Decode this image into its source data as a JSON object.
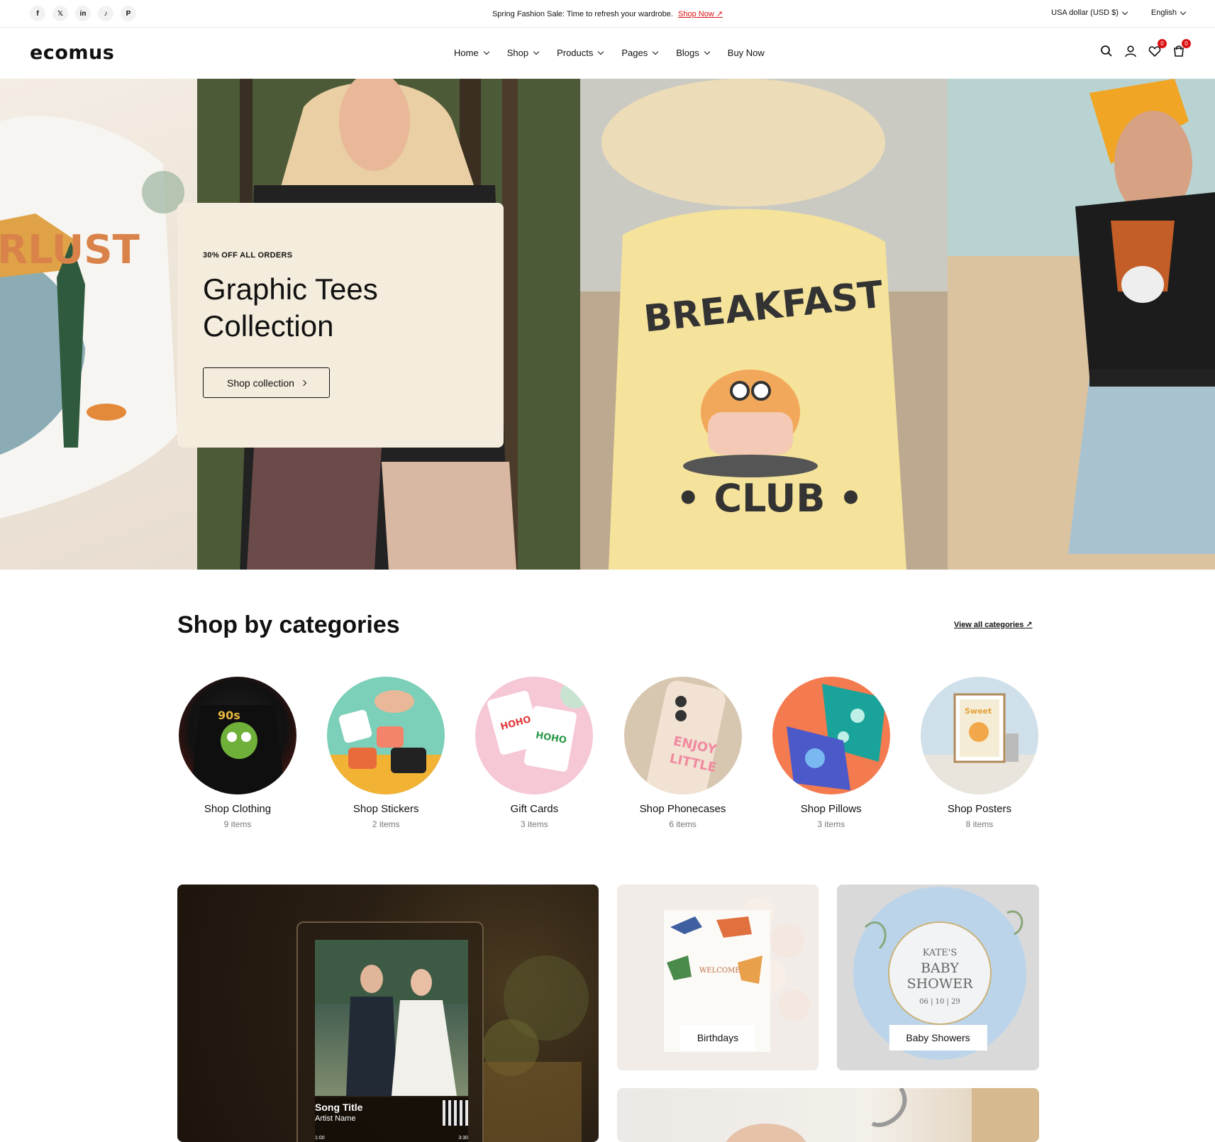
{
  "topbar": {
    "socials": [
      {
        "icon": "facebook-icon",
        "glyph": "f"
      },
      {
        "icon": "x-icon",
        "glyph": "𝕏"
      },
      {
        "icon": "linkedin-icon",
        "glyph": "in"
      },
      {
        "icon": "tiktok-icon",
        "glyph": "♪"
      },
      {
        "icon": "pinterest-icon",
        "glyph": "P"
      }
    ],
    "announcement": "Spring Fashion Sale: Time to refresh your wardrobe.",
    "announcement_link": "Shop Now ↗",
    "currency": "USA dollar (USD $)",
    "language": "English"
  },
  "header": {
    "logo": "ecomus",
    "nav": [
      "Home",
      "Shop",
      "Products",
      "Pages",
      "Blogs",
      "Buy Now"
    ],
    "wishlist_count": "0",
    "cart_count": "0"
  },
  "hero": {
    "tag": "30% OFF ALL ORDERS",
    "title_line1": "Graphic Tees",
    "title_line2": "Collection",
    "button": "Shop collection"
  },
  "categories": {
    "title": "Shop by categories",
    "view_all": "View all categories ↗",
    "items": [
      {
        "name": "Shop Clothing",
        "count": "9 items",
        "colors": [
          "#7a1a12",
          "#111111"
        ]
      },
      {
        "name": "Shop Stickers",
        "count": "2 items",
        "colors": [
          "#7ccfb8",
          "#f2b233"
        ]
      },
      {
        "name": "Gift Cards",
        "count": "3 items",
        "colors": [
          "#f6c7d4",
          "#ffffff"
        ]
      },
      {
        "name": "Shop Phonecases",
        "count": "6 items",
        "colors": [
          "#d8c7b0",
          "#f1e2d3"
        ]
      },
      {
        "name": "Shop Pillows",
        "count": "3 items",
        "colors": [
          "#f47a4f",
          "#1aa39a"
        ]
      },
      {
        "name": "Shop Posters",
        "count": "8 items",
        "colors": [
          "#cfe0ea",
          "#e9e5dc"
        ]
      }
    ]
  },
  "collections": {
    "song_title": "Song Title",
    "artist_name": "Artist Name",
    "time_start": "1:00",
    "time_end": "3:30",
    "birthdays": "Birthdays",
    "baby_showers": "Baby Showers",
    "plate_line1": "KATE'S",
    "plate_line2": "BABY",
    "plate_line3": "SHOWER",
    "plate_date": "06 | 10 | 29",
    "invite_text": "WELCOME"
  },
  "colors": {
    "accent": "#db1215",
    "promo_bg": "#f4ecdc"
  }
}
